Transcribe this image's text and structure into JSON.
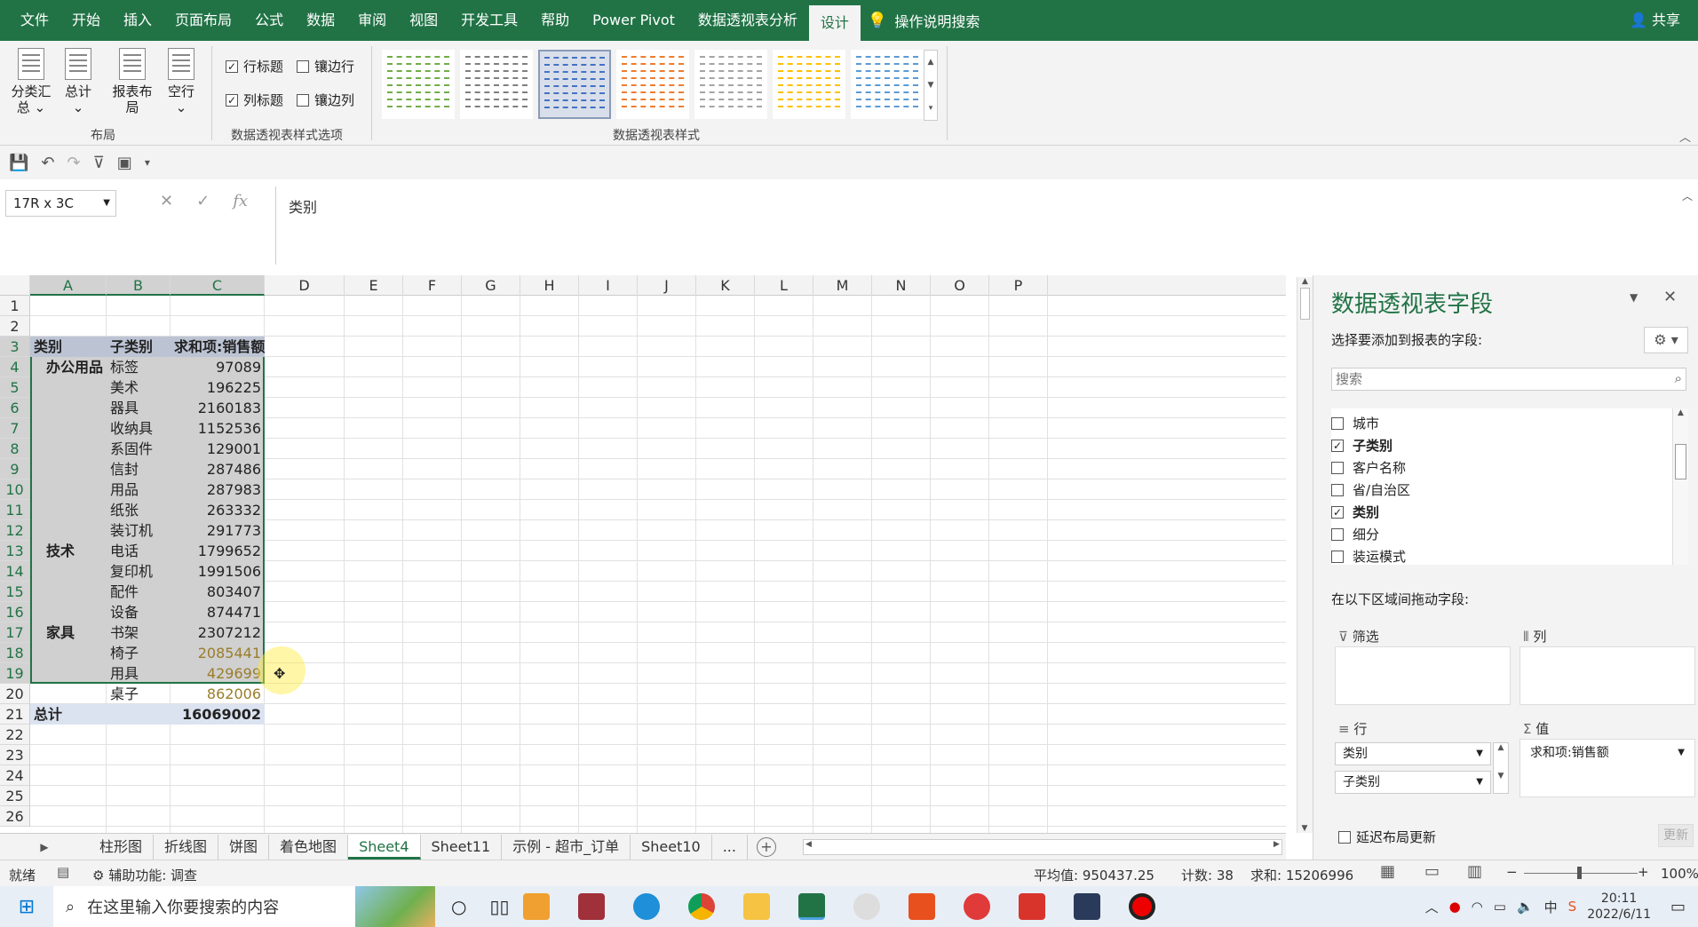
{
  "menu": {
    "tabs": [
      "文件",
      "开始",
      "插入",
      "页面布局",
      "公式",
      "数据",
      "审阅",
      "视图",
      "开发工具",
      "帮助",
      "Power Pivot",
      "数据透视表分析",
      "设计"
    ],
    "active": "设计",
    "search": "操作说明搜索",
    "share": "共享"
  },
  "ribbon": {
    "layout_group": {
      "label": "布局",
      "buttons": [
        "分类汇总",
        "总计",
        "报表布局",
        "空行"
      ]
    },
    "options_group": {
      "label": "数据透视表样式选项",
      "row_header": "行标题",
      "col_header": "列标题",
      "banded_rows": "镶边行",
      "banded_cols": "镶边列"
    },
    "styles_group": {
      "label": "数据透视表样式"
    },
    "style_colors": [
      "#70ad47",
      "#7f7f7f",
      "#4472c4",
      "#ed7d31",
      "#a5a5a5",
      "#ffc000",
      "#5b9bd5"
    ]
  },
  "formula": {
    "namebox": "17R x 3C",
    "content": "类别",
    "fx": "fx"
  },
  "columns": [
    "A",
    "B",
    "C",
    "D",
    "E",
    "F",
    "G",
    "H",
    "I",
    "J",
    "K",
    "L",
    "M",
    "N",
    "O",
    "P"
  ],
  "rows": [
    "1",
    "2",
    "3",
    "4",
    "5",
    "6",
    "7",
    "8",
    "9",
    "10",
    "11",
    "12",
    "13",
    "14",
    "15",
    "16",
    "17",
    "18",
    "19",
    "20",
    "21",
    "22",
    "23",
    "24",
    "25",
    "26"
  ],
  "pivot": {
    "headers": [
      "类别",
      "子类别",
      "求和项:销售额"
    ],
    "groups": [
      {
        "name": "办公用品",
        "items": [
          [
            "标签",
            "97089"
          ],
          [
            "美术",
            "196225"
          ],
          [
            "器具",
            "2160183"
          ],
          [
            "收纳具",
            "1152536"
          ],
          [
            "系固件",
            "129001"
          ],
          [
            "信封",
            "287486"
          ],
          [
            "用品",
            "287983"
          ],
          [
            "纸张",
            "263332"
          ],
          [
            "装订机",
            "291773"
          ]
        ]
      },
      {
        "name": "技术",
        "items": [
          [
            "电话",
            "1799652"
          ],
          [
            "复印机",
            "1991506"
          ],
          [
            "配件",
            "803407"
          ],
          [
            "设备",
            "874471"
          ]
        ]
      },
      {
        "name": "家具",
        "items": [
          [
            "书架",
            "2307212"
          ],
          [
            "椅子",
            "2085441"
          ],
          [
            "用具",
            "429699"
          ],
          [
            "桌子",
            "862006"
          ]
        ]
      }
    ],
    "total_label": "总计",
    "total_value": "16069002"
  },
  "sheet_tabs": [
    "柱形图",
    "折线图",
    "饼图",
    "着色地图",
    "Sheet4",
    "Sheet11",
    "示例 - 超市_订单",
    "Sheet10",
    "..."
  ],
  "active_sheet": "Sheet4",
  "status": {
    "ready": "就绪",
    "accessibility": "辅助功能: 调查",
    "average": "平均值: 950437.25",
    "count": "计数: 38",
    "sum": "求和: 15206996",
    "zoom": "100%"
  },
  "pane": {
    "title": "数据透视表字段",
    "subtitle": "选择要添加到报表的字段:",
    "search_placeholder": "搜索",
    "fields": [
      {
        "name": "城市",
        "checked": false
      },
      {
        "name": "子类别",
        "checked": true
      },
      {
        "name": "客户名称",
        "checked": false
      },
      {
        "name": "省/自治区",
        "checked": false
      },
      {
        "name": "类别",
        "checked": true
      },
      {
        "name": "细分",
        "checked": false
      },
      {
        "name": "装运模式",
        "checked": false
      }
    ],
    "drag_label": "在以下区域间拖动字段:",
    "filter": "筛选",
    "columns": "列",
    "rows": "行",
    "values": "值",
    "row_fields": [
      "类别",
      "子类别"
    ],
    "value_fields": [
      "求和项:销售额"
    ],
    "defer": "延迟布局更新",
    "update": "更新"
  },
  "taskbar": {
    "search": "在这里输入你要搜索的内容",
    "time": "20:11",
    "date": "2022/6/11"
  }
}
